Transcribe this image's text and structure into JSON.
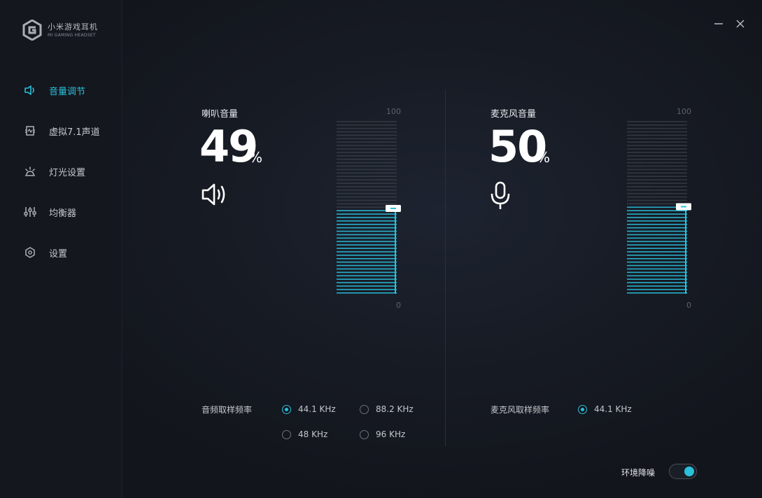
{
  "app": {
    "title": "小米游戏耳机",
    "subtitle": "MI GAMING HEADSET"
  },
  "sidebar": {
    "items": [
      {
        "label": "音量调节",
        "icon": "speaker-icon",
        "active": true
      },
      {
        "label": "虚拟7.1声道",
        "icon": "surround-icon",
        "active": false
      },
      {
        "label": "灯光设置",
        "icon": "light-icon",
        "active": false
      },
      {
        "label": "均衡器",
        "icon": "equalizer-icon",
        "active": false
      },
      {
        "label": "设置",
        "icon": "hexagon-settings-icon",
        "active": false
      }
    ]
  },
  "window": {
    "minimize": "minimize-icon",
    "close": "close-icon"
  },
  "speaker": {
    "label": "喇叭音量",
    "value": "49",
    "unit": "%",
    "level": 0.49,
    "scale_max": "100",
    "scale_min": "0",
    "rate_label": "音频取样频率",
    "rates": [
      {
        "label": "44.1 KHz",
        "checked": true
      },
      {
        "label": "88.2 KHz",
        "checked": false
      },
      {
        "label": "48 KHz",
        "checked": false
      },
      {
        "label": "96 KHz",
        "checked": false
      }
    ]
  },
  "mic": {
    "label": "麦克风音量",
    "value": "50",
    "unit": "%",
    "level": 0.5,
    "scale_max": "100",
    "scale_min": "0",
    "rate_label": "麦克风取样频率",
    "rates": [
      {
        "label": "44.1 KHz",
        "checked": true
      }
    ]
  },
  "noise_reduction": {
    "label": "环境降噪",
    "on": true
  },
  "colors": {
    "accent": "#29c0db",
    "bar_inactive": "#3b3f47"
  }
}
